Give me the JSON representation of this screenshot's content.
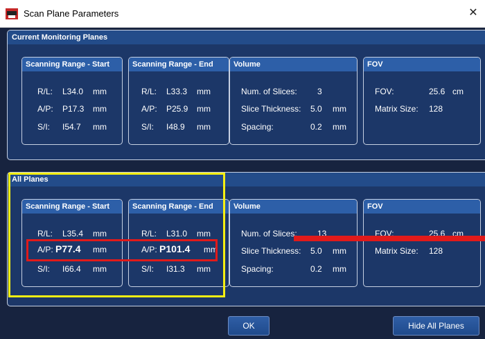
{
  "window": {
    "title": "Scan Plane Parameters",
    "close_glyph": "✕"
  },
  "current": {
    "title": "Current Monitoring Planes",
    "start": {
      "title": "Scanning Range - Start",
      "rl_label": "R/L:",
      "rl_value": "L34.0",
      "rl_unit": "mm",
      "ap_label": "A/P:",
      "ap_value": "P17.3",
      "ap_unit": "mm",
      "si_label": "S/I:",
      "si_value": "I54.7",
      "si_unit": "mm"
    },
    "end": {
      "title": "Scanning Range - End",
      "rl_label": "R/L:",
      "rl_value": "L33.3",
      "rl_unit": "mm",
      "ap_label": "A/P:",
      "ap_value": "P25.9",
      "ap_unit": "mm",
      "si_label": "S/I:",
      "si_value": "I48.9",
      "si_unit": "mm"
    },
    "volume": {
      "title": "Volume",
      "slices_label": "Num. of Slices:",
      "slices_value": "3",
      "thick_label": "Slice Thickness:",
      "thick_value": "5.0",
      "thick_unit": "mm",
      "spacing_label": "Spacing:",
      "spacing_value": "0.2",
      "spacing_unit": "mm"
    },
    "fov": {
      "title": "FOV",
      "fov_label": "FOV:",
      "fov_value": "25.6",
      "fov_unit": "cm",
      "matrix_label": "Matrix Size:",
      "matrix_value": "128"
    }
  },
  "all": {
    "title": "All Planes",
    "start": {
      "title": "Scanning Range - Start",
      "rl_label": "R/L:",
      "rl_value": "L35.4",
      "rl_unit": "mm",
      "ap_label": "A/P:",
      "ap_value": "P77.4",
      "ap_unit": "mm",
      "si_label": "S/I:",
      "si_value": "I66.4",
      "si_unit": "mm"
    },
    "end": {
      "title": "Scanning Range - End",
      "rl_label": "R/L:",
      "rl_value": "L31.0",
      "rl_unit": "mm",
      "ap_label": "A/P:",
      "ap_value": "P101.4",
      "ap_unit": "mm",
      "si_label": "S/I:",
      "si_value": "I31.3",
      "si_unit": "mm"
    },
    "volume": {
      "title": "Volume",
      "slices_label": "Num. of Slices:",
      "slices_value": "13",
      "thick_label": "Slice Thickness:",
      "thick_value": "5.0",
      "thick_unit": "mm",
      "spacing_label": "Spacing:",
      "spacing_value": "0.2",
      "spacing_unit": "mm"
    },
    "fov": {
      "title": "FOV",
      "fov_label": "FOV:",
      "fov_value": "25.6",
      "fov_unit": "cm",
      "matrix_label": "Matrix Size:",
      "matrix_value": "128"
    }
  },
  "buttons": {
    "ok": "OK",
    "hide_all": "Hide All Planes"
  },
  "colors": {
    "dialog_bg": "#17233f",
    "panel_bg": "#1c3768",
    "header_bg": "#2d5fa8",
    "highlight_yellow": "#f5ef12",
    "highlight_red": "#e11a1a"
  }
}
